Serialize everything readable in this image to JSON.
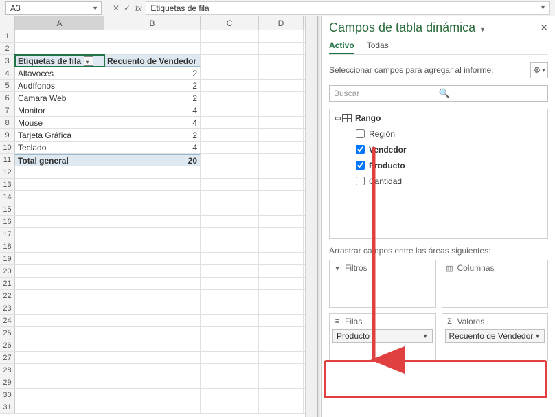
{
  "formula_bar": {
    "cell_ref": "A3",
    "formula": "Etiquetas de fila"
  },
  "columns": [
    "A",
    "B",
    "C",
    "D"
  ],
  "sheet": {
    "rows": [
      {
        "n": 1,
        "a": "",
        "b": ""
      },
      {
        "n": 2,
        "a": "",
        "b": ""
      },
      {
        "n": 3,
        "a": "Etiquetas de fila",
        "b": "Recuento de Vendedor",
        "header": true,
        "filter": true,
        "selected": true
      },
      {
        "n": 4,
        "a": "Altavoces",
        "b": "2"
      },
      {
        "n": 5,
        "a": "Audífonos",
        "b": "2"
      },
      {
        "n": 6,
        "a": "Camara Web",
        "b": "2"
      },
      {
        "n": 7,
        "a": "Monitor",
        "b": "4"
      },
      {
        "n": 8,
        "a": "Mouse",
        "b": "4"
      },
      {
        "n": 9,
        "a": "Tarjeta Gráfica",
        "b": "2"
      },
      {
        "n": 10,
        "a": "Teclado",
        "b": "4"
      },
      {
        "n": 11,
        "a": "Total general",
        "b": "20",
        "total": true
      },
      {
        "n": 12
      },
      {
        "n": 13
      },
      {
        "n": 14
      },
      {
        "n": 15
      },
      {
        "n": 16
      },
      {
        "n": 17
      },
      {
        "n": 18
      },
      {
        "n": 19
      },
      {
        "n": 20
      },
      {
        "n": 21
      },
      {
        "n": 22
      },
      {
        "n": 23
      },
      {
        "n": 24
      },
      {
        "n": 25
      },
      {
        "n": 26
      },
      {
        "n": 27
      },
      {
        "n": 28
      },
      {
        "n": 29
      },
      {
        "n": 30
      },
      {
        "n": 31
      }
    ]
  },
  "panel": {
    "title": "Campos de tabla dinámica",
    "tab_active": "Activo",
    "tab_all": "Todas",
    "select_hint": "Seleccionar campos para agregar al informe:",
    "search_placeholder": "Buscar",
    "group": "Rango",
    "fields": [
      {
        "label": "Región",
        "checked": false,
        "bold": false
      },
      {
        "label": "Vendedor",
        "checked": true,
        "bold": true
      },
      {
        "label": "Producto",
        "checked": true,
        "bold": true
      },
      {
        "label": "Cantidad",
        "checked": false,
        "bold": false
      }
    ],
    "drag_hint": "Arrastrar campos entre las áreas siguientes:",
    "areas": {
      "filters": "Filtros",
      "columns": "Columnas",
      "rows": "Filas",
      "values": "Valores",
      "rows_item": "Producto",
      "values_item": "Recuento de Vendedor"
    }
  }
}
